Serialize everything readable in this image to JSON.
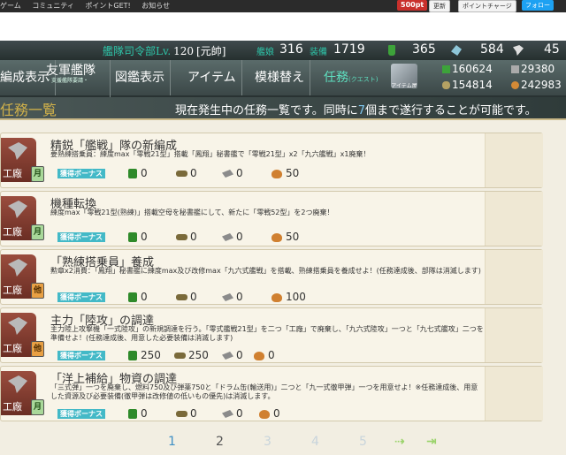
{
  "site_nav": {
    "items": [
      "ゲーム",
      "コミュニティ",
      "ポイントGET!",
      "お知らせ"
    ],
    "points": "500pt",
    "update_label": "更新",
    "charge_label": "ポイントチャージ",
    "follow_label": "フォロー"
  },
  "status": {
    "fleet_label": "艦隊司令部Lv.",
    "level": "120",
    "rank": "[元帥]",
    "ships_label": "艦娘",
    "ships": "316",
    "equip_label": "装備",
    "equip": "1719",
    "buckets": "365",
    "screws": "584",
    "dev_mats": "45"
  },
  "menu": {
    "items": [
      {
        "label": "編成表示"
      },
      {
        "label": "友軍艦隊",
        "sub": "・支援艦隊要請・"
      },
      {
        "label": "図鑑表示"
      },
      {
        "label": "アイテム"
      },
      {
        "label": "模様替え"
      },
      {
        "label": "任務",
        "kana": "(クエスト)"
      }
    ],
    "item_shop_label": "アイテム屋"
  },
  "resources": {
    "fuel": "160624",
    "ammo": "154814",
    "steel": "29380",
    "bauxite": "242983"
  },
  "page": {
    "title": "任務一覧",
    "desc_prefix": "現在発生中の任務一覧です。同時に",
    "desc_count": "7",
    "desc_suffix": "個まで遂行することが可能です。"
  },
  "quests": [
    {
      "category": "工廠",
      "freq": "月",
      "title": "精鋭「艦戦」隊の新編成",
      "desc": "要熟練搭乗員：練度max「零戦21型」搭載「鳳翔」秘書艦で「零戦21型」x2「九六艦戦」x1廃棄！",
      "bonus": "獲得ボーナス",
      "fuel": "0",
      "ammo": "0",
      "steel": "0",
      "baux": "50"
    },
    {
      "category": "工廠",
      "freq": "月",
      "title": "機種転換",
      "desc": "練度max「零戦21型(熟練)」搭載空母を秘書艦にして、新たに「零戦52型」を2つ廃棄！",
      "bonus": "獲得ボーナス",
      "fuel": "0",
      "ammo": "0",
      "steel": "0",
      "baux": "50"
    },
    {
      "category": "工廠",
      "freq": "他",
      "title": "「熟練搭乗員」養成",
      "desc": "勲章x2消費：「鳳翔」秘書艦に練度max及び改修max「九六式艦戦」を搭載、熟練搭乗員を養成せよ！(任務達成後、部隊は消滅します)",
      "bonus": "獲得ボーナス",
      "fuel": "0",
      "ammo": "0",
      "steel": "0",
      "baux": "100"
    },
    {
      "category": "工廠",
      "freq": "他",
      "title": "主力「陸攻」の調達",
      "desc": "主力陸上攻撃機「一式陸攻」の新規調達を行う。「零式艦戦21型」を二つ「工廠」で廃棄し、「九六式陸攻」一つと「九七式艦攻」二つを準備せよ！(任務達成後、用意した必要装備は消滅します)",
      "bonus": "獲得ボーナス",
      "fuel": "250",
      "ammo": "250",
      "steel": "0",
      "baux": "0"
    },
    {
      "category": "工廠",
      "freq": "月",
      "title": "「洋上補給」物資の調達",
      "desc": "「三式弾」一つを廃棄し、燃料750及び弾薬750と「ドラム缶(輸送用)」二つと「九一式徹甲弾」一つを用意せよ！※任務達成後、用意した資源及び必要装備(徹甲弾は改修値の低いもの優先)は消滅します。",
      "bonus": "獲得ボーナス",
      "fuel": "0",
      "ammo": "0",
      "steel": "0",
      "baux": "0"
    }
  ],
  "pager": {
    "pages": [
      "1",
      "2",
      "3",
      "4",
      "5"
    ],
    "current": "1",
    "next": "⇢",
    "last": "⇥"
  }
}
